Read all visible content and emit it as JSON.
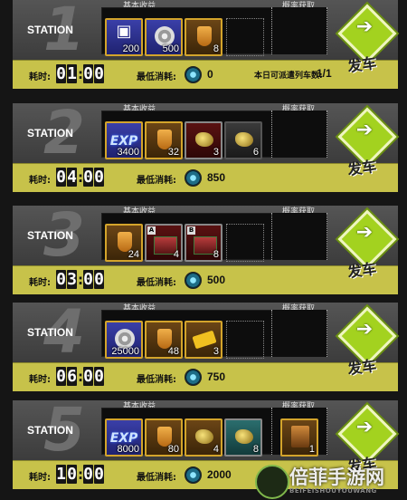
{
  "labels": {
    "station": "STATION",
    "base_reward": "基本收益",
    "probability": "概率获取",
    "depart": "发车",
    "time_cost": "耗时:",
    "min_cost": "最低消耗:",
    "dispatch_label": "本日可派遣列车数:"
  },
  "stations": [
    {
      "number": "1",
      "time": [
        "0",
        "1",
        "0",
        "0"
      ],
      "cost": "0",
      "rewards": [
        {
          "icon": "card-icon",
          "qty": "200"
        },
        {
          "icon": "disc-icon",
          "qty": "500"
        },
        {
          "icon": "shield-icon",
          "qty": "8"
        }
      ],
      "probability": [],
      "dispatch_value": "1/1"
    },
    {
      "number": "2",
      "time": [
        "0",
        "4",
        "0",
        "0"
      ],
      "cost": "850",
      "rewards": [
        {
          "icon": "exp-icon",
          "qty": "3400"
        },
        {
          "icon": "shield-icon",
          "qty": "32"
        },
        {
          "icon": "gold-ore-icon",
          "qty": "3"
        },
        {
          "icon": "gold-ore-icon",
          "qty": "6"
        }
      ],
      "probability": []
    },
    {
      "number": "3",
      "time": [
        "0",
        "3",
        "0",
        "0"
      ],
      "cost": "500",
      "rewards": [
        {
          "icon": "shield-icon",
          "qty": "24"
        },
        {
          "icon": "machine-icon",
          "qty": "4"
        },
        {
          "icon": "machine-icon",
          "qty": "8"
        }
      ],
      "probability": []
    },
    {
      "number": "4",
      "time": [
        "0",
        "6",
        "0",
        "0"
      ],
      "cost": "750",
      "rewards": [
        {
          "icon": "disc-icon",
          "qty": "25000"
        },
        {
          "icon": "shield-icon",
          "qty": "48"
        },
        {
          "icon": "ticket-icon",
          "qty": "3"
        }
      ],
      "probability": []
    },
    {
      "number": "5",
      "time": [
        "1",
        "0",
        "0",
        "0"
      ],
      "cost": "2000",
      "rewards": [
        {
          "icon": "exp-icon",
          "qty": "8000"
        },
        {
          "icon": "shield-icon",
          "qty": "80"
        },
        {
          "icon": "gold-ore-icon",
          "qty": "4"
        },
        {
          "icon": "gold-ore-icon",
          "qty": "8"
        }
      ],
      "probability": [
        {
          "icon": "robot-icon",
          "qty": "1"
        }
      ]
    }
  ],
  "watermark": {
    "text": "倍菲手游网",
    "sub": "BEIFEISHOUYOUWANG"
  }
}
